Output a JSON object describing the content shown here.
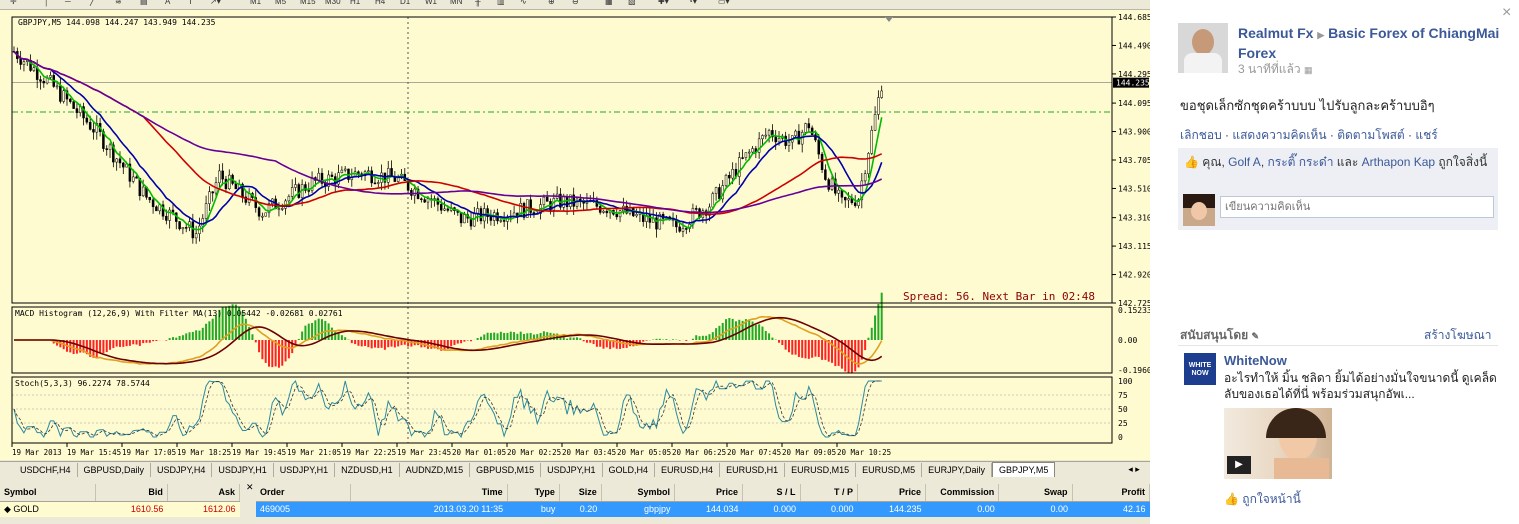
{
  "toolbar": {
    "periods": [
      "M1",
      "M5",
      "M15",
      "M30",
      "H1",
      "H4",
      "D1",
      "W1",
      "MN"
    ]
  },
  "chart": {
    "header": "GBPJPY,M5  144.098 144.247 143.949 144.235",
    "price_levels": [
      "144.685",
      "144.490",
      "144.295",
      "144.095",
      "143.900",
      "143.705",
      "143.510",
      "143.310",
      "143.115",
      "142.920",
      "142.725"
    ],
    "current_price": "144.235",
    "spread_text": "Spread: 56. Next Bar in 02:48",
    "macd_header": "MACD Histogram (12,26,9) With Filter MA(13) 0.05442 -0.02681 0.02761",
    "macd_levels": [
      "0.15233",
      "0.00",
      "-0.19604"
    ],
    "stoch_header": "Stoch(5,3,3) 96.2274 78.5744",
    "stoch_levels": [
      "100",
      "75",
      "50",
      "25",
      "0"
    ],
    "time_labels": [
      "19 Mar 2013",
      "19 Mar 15:45",
      "19 Mar 17:05",
      "19 Mar 18:25",
      "19 Mar 19:45",
      "19 Mar 21:05",
      "19 Mar 22:25",
      "19 Mar 23:45",
      "20 Mar 01:05",
      "20 Mar 02:25",
      "20 Mar 03:45",
      "20 Mar 05:05",
      "20 Mar 06:25",
      "20 Mar 07:45",
      "20 Mar 09:05",
      "20 Mar 10:25"
    ],
    "colors": {
      "bg": "#fffbd1",
      "bull": "#22aa22",
      "bear": "#ff2222",
      "ma_fast": "#00bb00",
      "ma_mid": "#0000aa",
      "ma_slow": "#cc0000",
      "ma_long": "#660099",
      "grid": "#888888"
    }
  },
  "symbol_tabs": [
    "USDCHF,H4",
    "GBPUSD,Daily",
    "USDJPY,H4",
    "USDJPY,H1",
    "USDJPY,H1",
    "NZDUSD,H1",
    "AUDNZD,M15",
    "GBPUSD,M15",
    "USDJPY,H1",
    "GOLD,H4",
    "EURUSD,H4",
    "EURUSD,H1",
    "EURUSD,M15",
    "EURUSD,M5",
    "EURJPY,Daily",
    "GBPJPY,M5"
  ],
  "active_tab": "GBPJPY,M5",
  "market_watch": {
    "headers": [
      "Symbol",
      "Bid",
      "Ask"
    ],
    "rows": [
      {
        "symbol": "GOLD",
        "bid": "1610.56",
        "ask": "1612.06"
      }
    ]
  },
  "orders": {
    "headers": [
      "Order",
      "Time",
      "Type",
      "Size",
      "Symbol",
      "Price",
      "S / L",
      "T / P",
      "Price",
      "Commission",
      "Swap",
      "Profit"
    ],
    "rows": [
      {
        "order": "469005",
        "time": "2013.03.20 11:35",
        "type": "buy",
        "size": "0.20",
        "symbol": "gbpjpy",
        "price": "144.034",
        "sl": "0.000",
        "tp": "0.000",
        "cur_price": "144.235",
        "commission": "0.00",
        "swap": "0.00",
        "profit": "42.16"
      }
    ]
  },
  "facebook": {
    "author": "Realmut Fx",
    "group": "Basic Forex of ChiangMai Forex",
    "time_ago": "3 นาทีที่แล้ว",
    "message": "ขอชุดเล็กซักชุดคร้าบบบ ไปรับลูกละคร้าบบอิๆ",
    "actions": [
      "เลิกชอบ",
      "แสดงความคิดเห็น",
      "ติดตามโพสต์",
      "แชร์"
    ],
    "likes_prefix": "คุณ, ",
    "like_user1": "Golf A",
    "like_user2": "กระติ๊ กระด๋า",
    "likes_and": " และ ",
    "like_user3": "Arthapon Kap",
    "likes_suffix": " ถูกใจสิ่งนี้",
    "comment_placeholder": "เขียนความคิดเห็น",
    "sponsored_title": "สนับสนุนโดย",
    "create_ad": "สร้างโฆษณา",
    "ad_title": "WhiteNow",
    "ad_logo_text": "WHITE NOW",
    "ad_text": "อะไรทำให้ มิ้น ชลิดา ยิ้มได้อย่างมั่นใจขนาดนี้ ดูเคล็ดลับของเธอได้ที่นี่ พร้อมร่วมสนุกอัพเ...",
    "ad_like": "ถูกใจหน้านี้",
    "close_icon": "×"
  }
}
